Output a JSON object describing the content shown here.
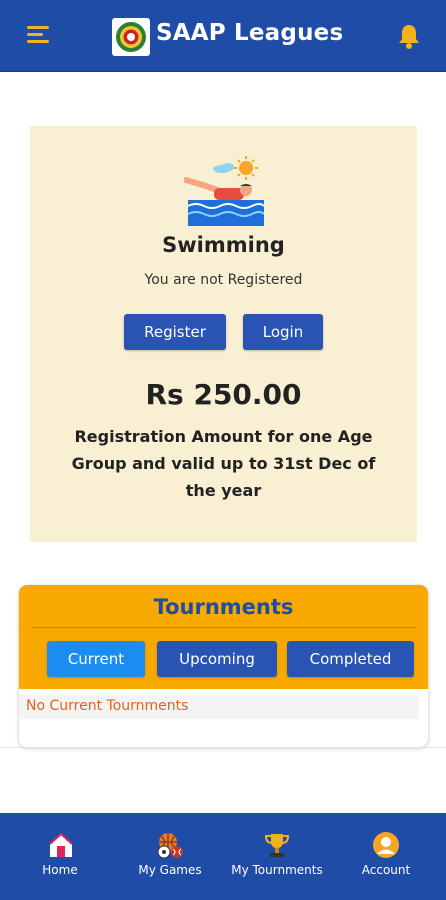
{
  "header": {
    "title": "SAAP Leagues",
    "menu_icon": "hamburger-menu-icon",
    "logo_icon": "saap-logo-icon",
    "notification_icon": "bell-icon"
  },
  "registration": {
    "sport_icon": "swimmer-icon",
    "sport_name": "Swimming",
    "status": "You are not Registered",
    "register_label": "Register",
    "login_label": "Login",
    "price": "Rs 250.00",
    "note": "Registration Amount for one Age Group and valid up to 31st Dec of the year"
  },
  "tournaments": {
    "title": "Tournments",
    "tabs": [
      {
        "label": "Current",
        "active": true
      },
      {
        "label": "Upcoming",
        "active": false
      },
      {
        "label": "Completed",
        "active": false
      }
    ],
    "empty_message": "No Current Tournments"
  },
  "bottom_nav": {
    "items": [
      {
        "label": "Home",
        "icon": "home-icon"
      },
      {
        "label": "My Games",
        "icon": "sports-balls-icon"
      },
      {
        "label": "My Tournments",
        "icon": "trophy-icon"
      },
      {
        "label": "Account",
        "icon": "user-avatar-icon"
      }
    ]
  },
  "colors": {
    "primary": "#1f4ca6",
    "accent": "#f8a900",
    "active_tab": "#1b8cf0",
    "card_bg": "#f9efd2",
    "warning_text": "#e2641a"
  }
}
